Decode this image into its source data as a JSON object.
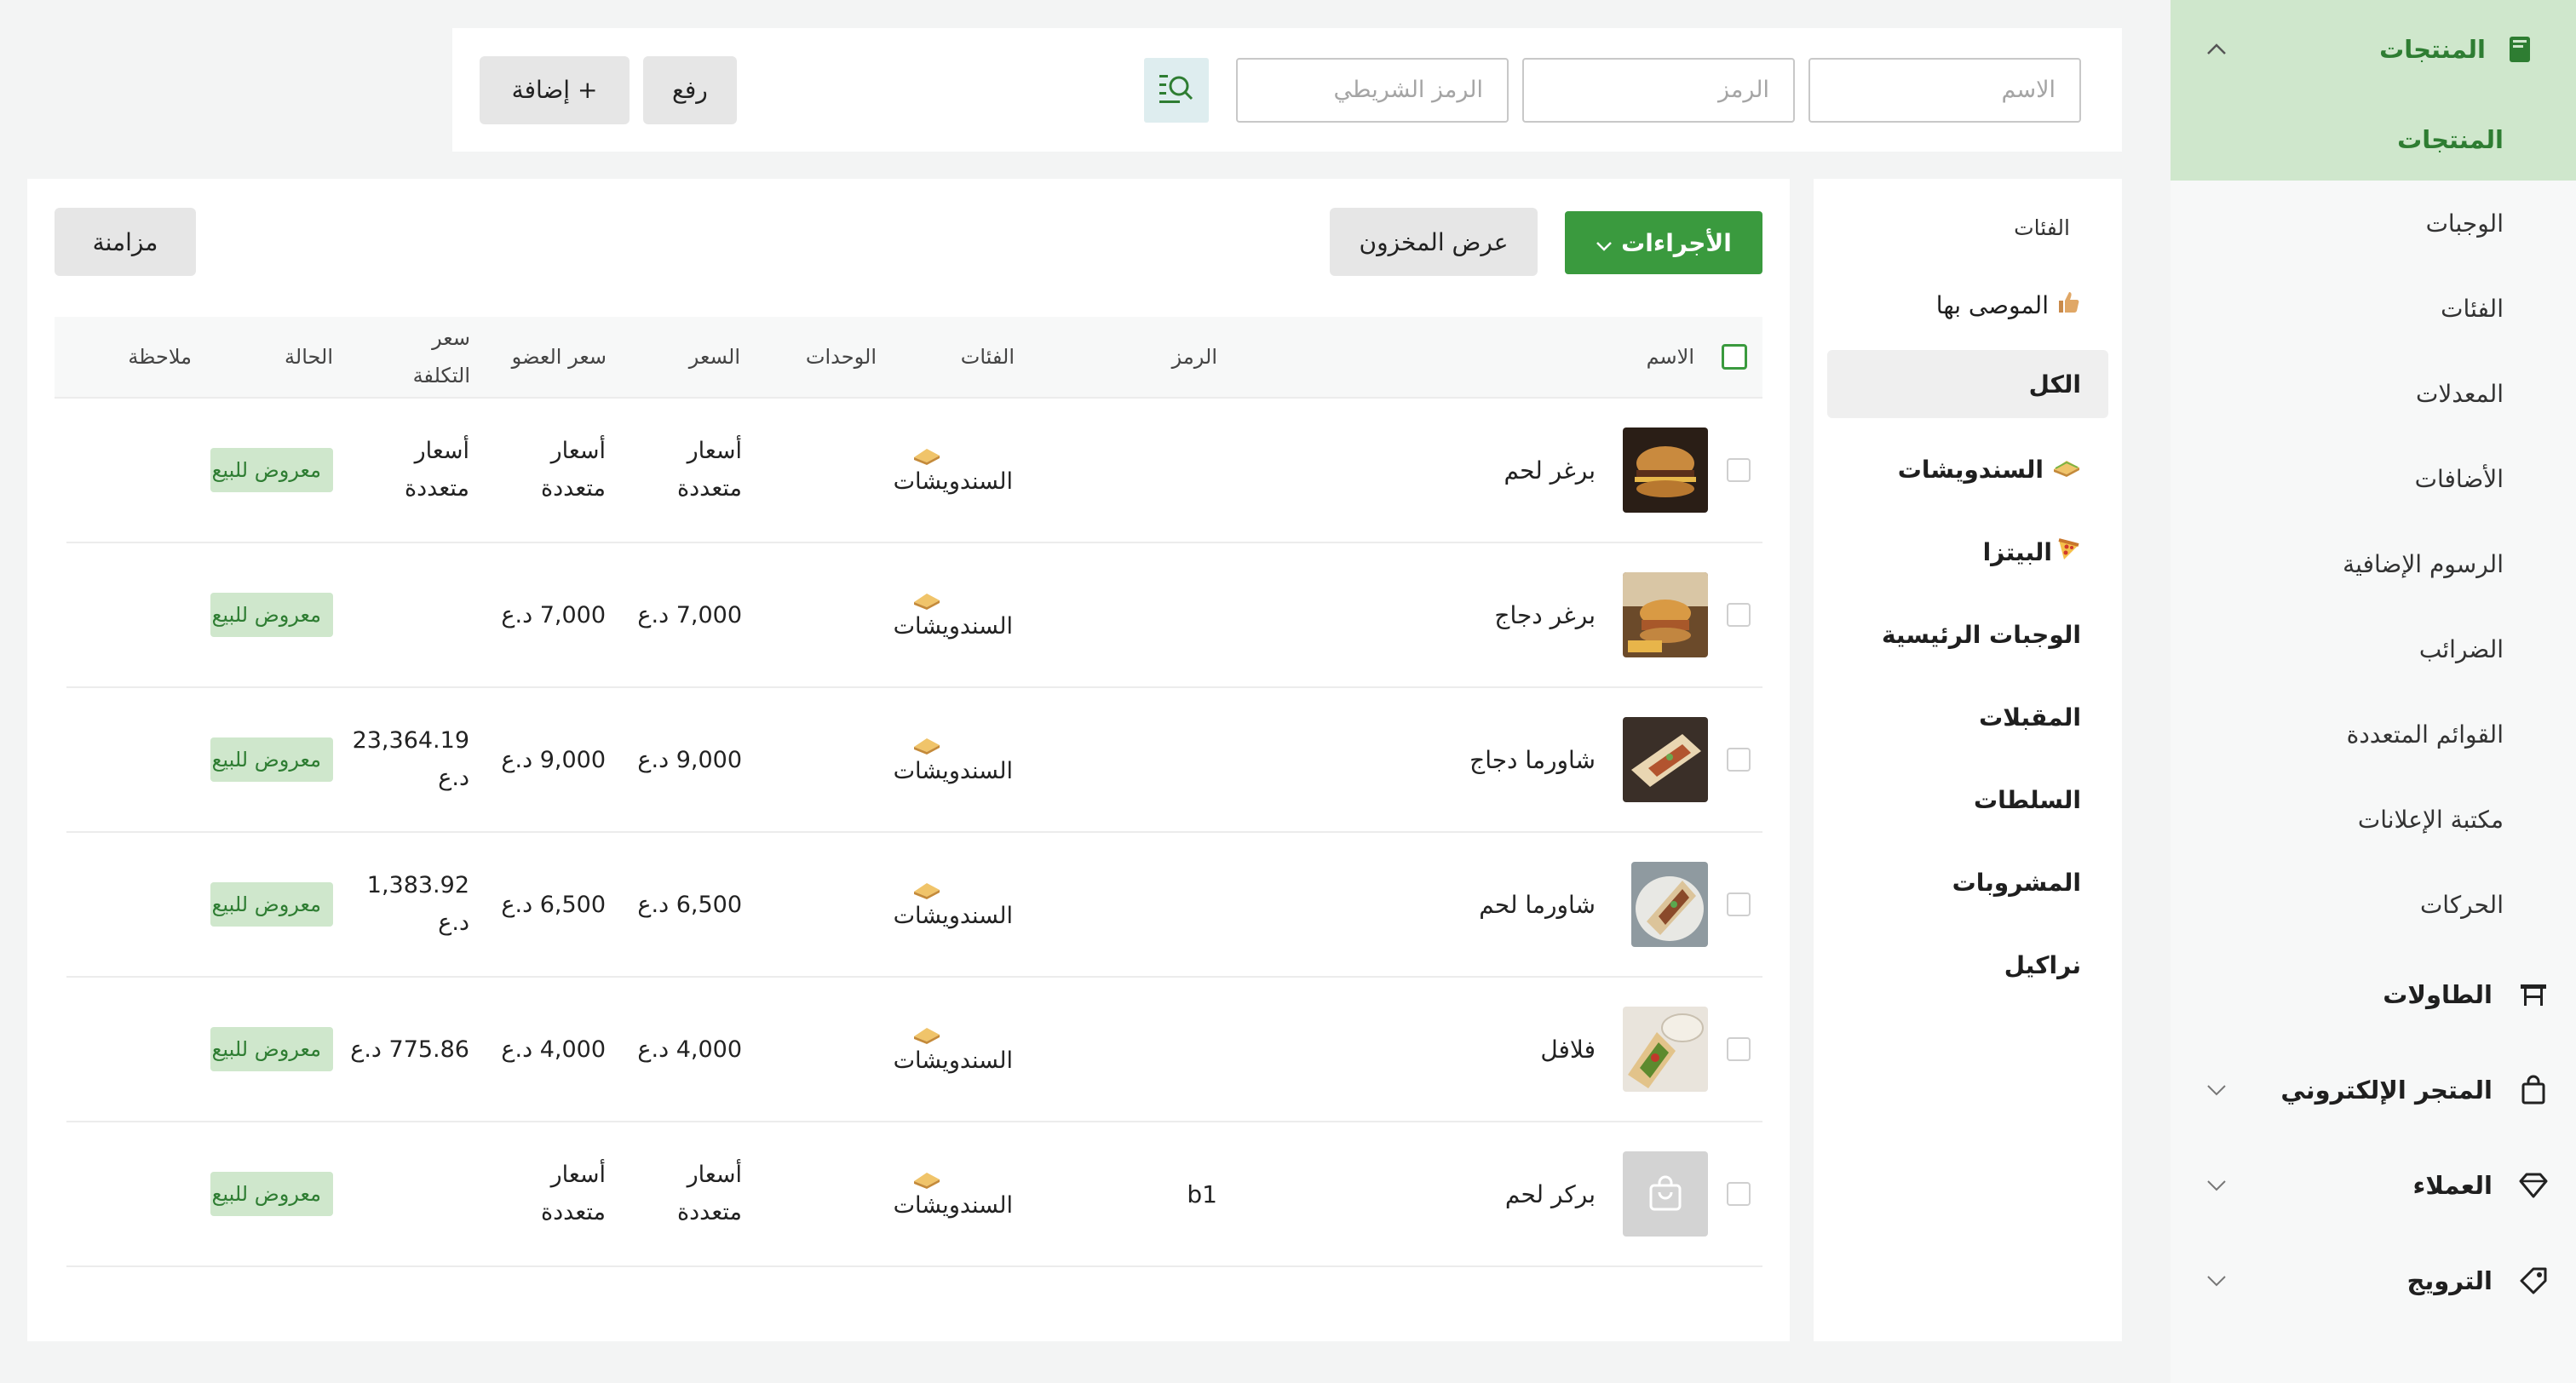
{
  "toolbar": {
    "name_placeholder": "الاسم",
    "code_placeholder": "الرمز",
    "barcode_placeholder": "الرمز الشريطي",
    "upload_label": "رفع",
    "add_label": "+ إضافة"
  },
  "nav": {
    "products_header": "المنتجات",
    "products_sub": "المنتجات",
    "items": [
      "الوجبات",
      "الفئات",
      "المعدلات",
      "الأضافات",
      "الرسوم الإضافية",
      "الضرائب",
      "القوائم المتعددة",
      "مكتبة الإعلانات",
      "الحركات"
    ],
    "tables": "الطاولات",
    "eshop": "المتجر الإلكتروني",
    "customers": "العملاء",
    "promotion": "الترويج"
  },
  "categories": {
    "heading": "الفئات",
    "recommended": "الموصى بها",
    "all": "الكل",
    "sandwiches": "السندويشات",
    "pizza": "البيتزا",
    "mains": "الوجبات الرئيسية",
    "appetizers": "المقبلات",
    "salads": "السلطات",
    "drinks": "المشروبات",
    "hookah": "نراكيل"
  },
  "main": {
    "actions_label": "الأجراءات",
    "stock_label": "عرض المخزون",
    "sync_label": "مزامنة"
  },
  "table": {
    "headers": {
      "name": "الاسم",
      "code": "الرمز",
      "categories": "الفئات",
      "units": "الوحدات",
      "price": "السعر",
      "member_price": "سعر العضو",
      "cost_price": "سعر التكلفة",
      "status": "الحالة",
      "note": "ملاحظة"
    },
    "rows": [
      {
        "name": "برغر لحم",
        "code": "",
        "category": "السندويشات",
        "price": "أسعار متعددة",
        "member": "أسعار متعددة",
        "cost": "أسعار متعددة",
        "status": "معروض للبيع"
      },
      {
        "name": "برغر دجاج",
        "code": "",
        "category": "السندويشات",
        "price": "7,000 د.ع",
        "member": "7,000 د.ع",
        "cost": "",
        "status": "معروض للبيع"
      },
      {
        "name": "شاورما دجاج",
        "code": "",
        "category": "السندويشات",
        "price": "9,000 د.ع",
        "member": "9,000 د.ع",
        "cost": "23,364.19 د.ع",
        "status": "معروض للبيع"
      },
      {
        "name": "شاورما لحم",
        "code": "",
        "category": "السندويشات",
        "price": "6,500 د.ع",
        "member": "6,500 د.ع",
        "cost": "1,383.92 د.ع",
        "status": "معروض للبيع"
      },
      {
        "name": "فلافل",
        "code": "",
        "category": "السندويشات",
        "price": "4,000 د.ع",
        "member": "4,000 د.ع",
        "cost": "775.86 د.ع",
        "status": "معروض للبيع"
      },
      {
        "name": "بركر لحم",
        "code": "b1",
        "category": "السندويشات",
        "price": "أسعار متعددة",
        "member": "أسعار متعددة",
        "cost": "",
        "status": "معروض للبيع"
      }
    ]
  },
  "colors": {
    "accent": "#3a9a3e",
    "accent_light": "#cfe7cc",
    "accent_text": "#2e7d32"
  }
}
